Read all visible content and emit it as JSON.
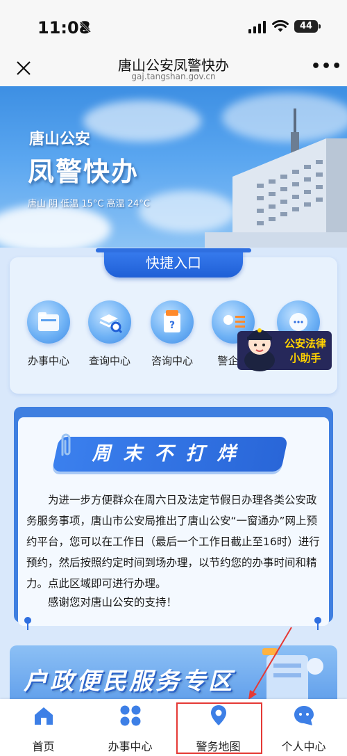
{
  "status_bar": {
    "time": "11:08",
    "battery": "44"
  },
  "nav": {
    "title": "唐山公安凤警快办",
    "url": "gaj.tangshan.gov.cn"
  },
  "banner": {
    "subtitle": "唐山公安",
    "title": "凤警快办",
    "weather": "唐山 阴 低温 15°C 高温 24°C"
  },
  "quick_access": {
    "title": "快捷入口",
    "items": [
      {
        "label": "办事中心",
        "icon": "folder-icon"
      },
      {
        "label": "查询中心",
        "icon": "search-stack-icon"
      },
      {
        "label": "咨询中心",
        "icon": "question-doc-icon"
      },
      {
        "label": "警企会",
        "icon": "card-icon"
      },
      {
        "label": "",
        "icon": "chat-icon"
      }
    ],
    "helper_line1": "公安法律",
    "helper_line2": "小助手"
  },
  "notice": {
    "title": "周末不打烊",
    "body": "为进一步方便群众在周六日及法定节假日办理各类公安政务服务事项，唐山市公安局推出了唐山公安“一窗通办”网上预约平台，您可以在工作日（最后一个工作日截止至16时）进行预约，然后按照约定时间到场办理，以节约您的办事时间和精力。点此区域即可进行办理。",
    "thanks": "感谢您对唐山公安的支持！"
  },
  "huzheng": {
    "title": "户政便民服务专区"
  },
  "tabbar": {
    "items": [
      {
        "label": "首页",
        "icon": "home-icon"
      },
      {
        "label": "办事中心",
        "icon": "grid-icon"
      },
      {
        "label": "警务地图",
        "icon": "map-pin-icon"
      },
      {
        "label": "个人中心",
        "icon": "chat-bubble-icon"
      }
    ],
    "highlighted": "警务地图"
  },
  "colors": {
    "primary": "#2f6fe0",
    "tab_icon": "#3d7fe6",
    "annotation": "#e53935",
    "helper_text": "#ffd200"
  }
}
